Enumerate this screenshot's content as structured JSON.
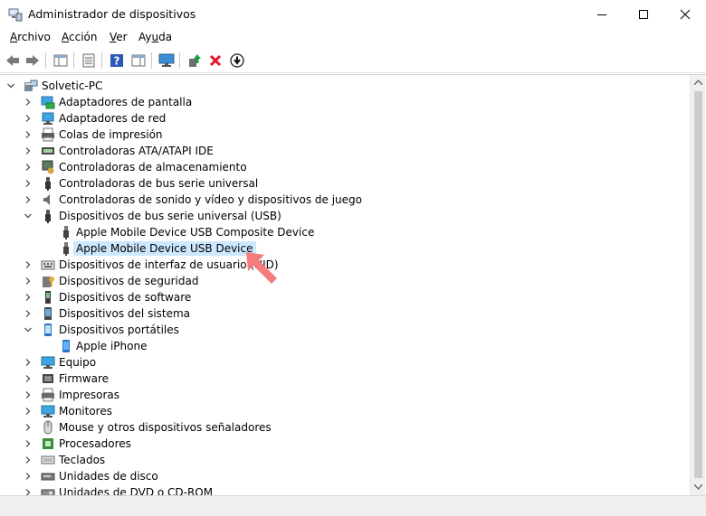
{
  "window": {
    "title": "Administrador de dispositivos",
    "icons": [
      "device-manager-icon",
      "minimize-icon",
      "maximize-icon",
      "close-icon"
    ]
  },
  "menu": {
    "items": [
      {
        "pre": "",
        "key": "A",
        "post": "rchivo"
      },
      {
        "pre": "",
        "key": "A",
        "post": "cción"
      },
      {
        "pre": "",
        "key": "V",
        "post": "er"
      },
      {
        "pre": "Ay",
        "key": "u",
        "post": "da"
      }
    ]
  },
  "toolbar": {
    "buttons": [
      "back-icon",
      "forward-icon",
      "show-hide-console-tree-icon",
      "properties-icon",
      "help-icon",
      "action-pane-icon",
      "scan-hardware-icon",
      "update-driver-icon",
      "uninstall-icon",
      "disable-device-icon"
    ]
  },
  "colors": {
    "selection": "#cce8ff",
    "accent": "#0078d7",
    "arrow": "#f47c7c",
    "uninstall": "#e81123"
  },
  "tree": {
    "root": "Solvetic-PC",
    "rows": [
      {
        "level": 0,
        "expander": "expanded",
        "icon": "computer-icon",
        "label": "Solvetic-PC",
        "selected": false
      },
      {
        "level": 1,
        "expander": "collapsed",
        "icon": "display-adapter-icon",
        "label": "Adaptadores de pantalla",
        "selected": false
      },
      {
        "level": 1,
        "expander": "collapsed",
        "icon": "network-adapter-icon",
        "label": "Adaptadores de red",
        "selected": false
      },
      {
        "level": 1,
        "expander": "collapsed",
        "icon": "print-queue-icon",
        "label": "Colas de impresión",
        "selected": false
      },
      {
        "level": 1,
        "expander": "collapsed",
        "icon": "ide-controller-icon",
        "label": "Controladoras ATA/ATAPI IDE",
        "selected": false
      },
      {
        "level": 1,
        "expander": "collapsed",
        "icon": "storage-controller-icon",
        "label": "Controladoras de almacenamiento",
        "selected": false
      },
      {
        "level": 1,
        "expander": "collapsed",
        "icon": "usb-icon",
        "label": "Controladoras de bus serie universal",
        "selected": false
      },
      {
        "level": 1,
        "expander": "collapsed",
        "icon": "speaker-icon",
        "label": "Controladoras de sonido y vídeo y dispositivos de juego",
        "selected": false
      },
      {
        "level": 1,
        "expander": "expanded",
        "icon": "usb-icon",
        "label": "Dispositivos de bus serie universal (USB)",
        "selected": false
      },
      {
        "level": 2,
        "expander": "none",
        "icon": "usb-device-icon",
        "label": "Apple Mobile Device USB Composite Device",
        "selected": false
      },
      {
        "level": 2,
        "expander": "none",
        "icon": "usb-device-icon",
        "label": "Apple Mobile Device USB Device",
        "selected": true
      },
      {
        "level": 1,
        "expander": "collapsed",
        "icon": "keyboard-hid-icon",
        "label": "Dispositivos de interfaz de usuario (HID)",
        "selected": false
      },
      {
        "level": 1,
        "expander": "collapsed",
        "icon": "security-device-icon",
        "label": "Dispositivos de seguridad",
        "selected": false
      },
      {
        "level": 1,
        "expander": "collapsed",
        "icon": "software-device-icon",
        "label": "Dispositivos de software",
        "selected": false
      },
      {
        "level": 1,
        "expander": "collapsed",
        "icon": "system-device-icon",
        "label": "Dispositivos del sistema",
        "selected": false
      },
      {
        "level": 1,
        "expander": "expanded",
        "icon": "portable-device-icon",
        "label": "Dispositivos portátiles",
        "selected": false
      },
      {
        "level": 2,
        "expander": "none",
        "icon": "phone-icon",
        "label": "Apple iPhone",
        "selected": false
      },
      {
        "level": 1,
        "expander": "collapsed",
        "icon": "computer-monitor-icon",
        "label": "Equipo",
        "selected": false
      },
      {
        "level": 1,
        "expander": "collapsed",
        "icon": "firmware-icon",
        "label": "Firmware",
        "selected": false
      },
      {
        "level": 1,
        "expander": "collapsed",
        "icon": "printer-icon",
        "label": "Impresoras",
        "selected": false
      },
      {
        "level": 1,
        "expander": "collapsed",
        "icon": "monitor-icon",
        "label": "Monitores",
        "selected": false
      },
      {
        "level": 1,
        "expander": "collapsed",
        "icon": "mouse-icon",
        "label": "Mouse y otros dispositivos señaladores",
        "selected": false
      },
      {
        "level": 1,
        "expander": "collapsed",
        "icon": "processor-icon",
        "label": "Procesadores",
        "selected": false
      },
      {
        "level": 1,
        "expander": "collapsed",
        "icon": "keyboard-icon",
        "label": "Teclados",
        "selected": false
      },
      {
        "level": 1,
        "expander": "collapsed",
        "icon": "disk-drive-icon",
        "label": "Unidades de disco",
        "selected": false
      },
      {
        "level": 1,
        "expander": "collapsed",
        "icon": "dvd-drive-icon",
        "label": "Unidades de DVD o CD-ROM",
        "selected": false
      }
    ]
  }
}
